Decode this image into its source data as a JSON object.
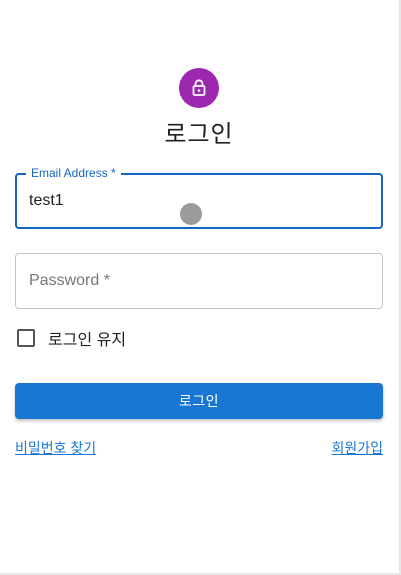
{
  "header": {
    "title": "로그인",
    "icon": "lock-icon",
    "accent_color": "#9c27b0"
  },
  "form": {
    "email": {
      "label": "Email Address *",
      "value": "test1"
    },
    "password": {
      "placeholder": "Password *"
    },
    "remember": {
      "label": "로그인 유지",
      "checked": false
    },
    "submit_label": "로그인",
    "primary_color": "#1976d2"
  },
  "links": {
    "find_password": "비밀번호 찾기",
    "signup": "회원가입"
  }
}
